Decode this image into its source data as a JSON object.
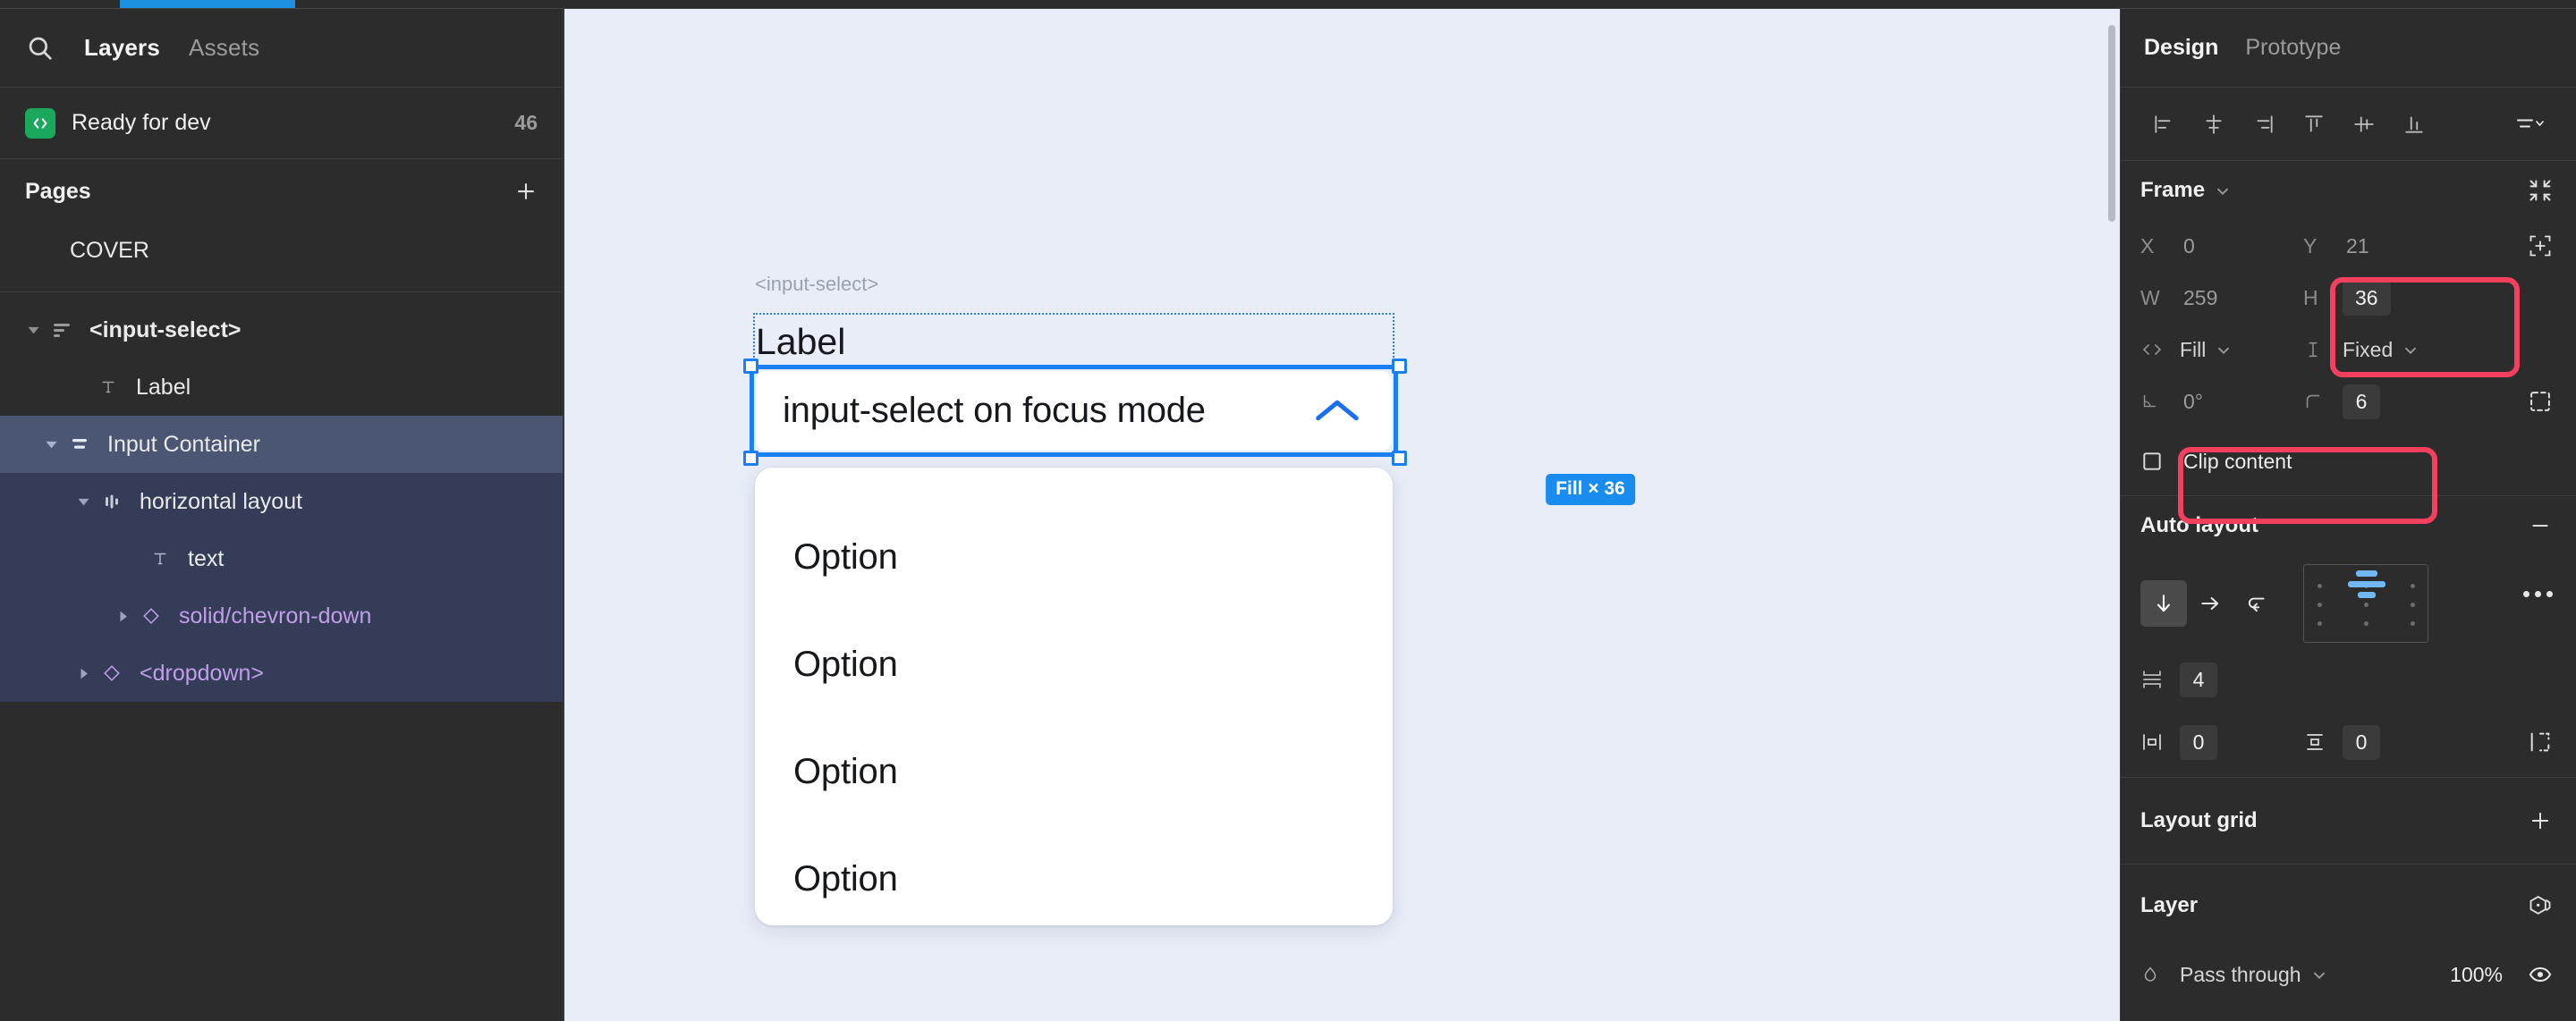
{
  "app": {
    "accent_blue": "#1a8cf0",
    "annotation_color": "#f43f5e",
    "canvas_bg": "#e9edf7",
    "panel_bg": "#2c2c2c"
  },
  "left_panel": {
    "tabs": [
      {
        "label": "Layers",
        "active": true
      },
      {
        "label": "Assets",
        "active": false
      }
    ],
    "search_icon": "search-icon",
    "dev_status": {
      "icon": "code-brackets-icon",
      "label": "Ready for dev",
      "count": "46"
    },
    "pages": {
      "title": "Pages",
      "add_icon": "plus-icon",
      "items": [
        {
          "label": "COVER",
          "selected": false
        }
      ]
    },
    "layers": [
      {
        "name": "<input-select>",
        "icon": "auto-layout-vertical-icon",
        "caret": "down",
        "indent": 0,
        "bold": true,
        "component": false,
        "selection": "none"
      },
      {
        "name": "Label",
        "icon": "text-icon",
        "caret": "none",
        "indent": 1,
        "bold": false,
        "component": false,
        "selection": "none"
      },
      {
        "name": "Input Container",
        "icon": "auto-layout-vertical-icon",
        "caret": "down",
        "indent": 1,
        "bold": false,
        "component": false,
        "selection": "light"
      },
      {
        "name": "horizontal layout",
        "icon": "auto-layout-horizontal-icon",
        "caret": "down",
        "indent": 2,
        "bold": false,
        "component": false,
        "selection": "dark"
      },
      {
        "name": "text",
        "icon": "text-icon",
        "caret": "none",
        "indent": 3,
        "bold": false,
        "component": false,
        "selection": "dark"
      },
      {
        "name": "solid/chevron-down",
        "icon": "component-instance-icon",
        "caret": "right",
        "indent": 3,
        "bold": false,
        "component": true,
        "selection": "dark"
      },
      {
        "name": "<dropdown>",
        "icon": "component-instance-icon",
        "caret": "right",
        "indent": 2,
        "bold": false,
        "component": true,
        "selection": "dark"
      }
    ]
  },
  "canvas": {
    "frame_name": "<input-select>",
    "label_text": "Label",
    "input_value": "input-select on focus mode",
    "input_chevron": "chevron-up-icon",
    "fill_badge": "Fill × 36",
    "dropdown_options": [
      "Option",
      "Option",
      "Option",
      "Option"
    ]
  },
  "right_panel": {
    "tabs": [
      {
        "label": "Design",
        "active": true
      },
      {
        "label": "Prototype",
        "active": false
      }
    ],
    "align_buttons": [
      "align-left-icon",
      "align-horizontal-center-icon",
      "align-right-icon",
      "align-top-icon",
      "align-vertical-center-icon",
      "align-bottom-icon",
      "distribute-more-icon"
    ],
    "frame": {
      "title": "Frame",
      "collapse_icon": "chevron-down-icon",
      "resize_icon": "resize-to-fit-icon",
      "x_label": "X",
      "x_value": "0",
      "y_label": "Y",
      "y_value": "21",
      "w_label": "W",
      "w_value": "259",
      "h_label": "H",
      "h_value": "36",
      "absolute_position_icon": "absolute-position-icon",
      "horizontal_resizing_icon": "horizontal-resizing-icon",
      "horizontal_resizing_value": "Fill",
      "vertical_resizing_icon": "vertical-resizing-icon",
      "vertical_resizing_value": "Fixed",
      "rotation_icon": "rotation-icon",
      "rotation_value": "0°",
      "corner_radius_icon": "corner-radius-icon",
      "corner_radius_value": "6",
      "independent_corners_icon": "independent-corners-icon",
      "clip_content_label": "Clip content",
      "clip_content_checked": false
    },
    "auto_layout": {
      "title": "Auto layout",
      "remove_icon": "minus-icon",
      "direction_vertical_icon": "arrow-down-icon",
      "direction_horizontal_icon": "arrow-right-icon",
      "wrap_icon": "wrap-icon",
      "direction_selected": "vertical",
      "alignment": "top-center",
      "gap_icon": "gap-icon",
      "gap_value": "4",
      "more_icon": "more-options-icon",
      "padding_h_icon": "padding-horizontal-icon",
      "padding_h_value": "0",
      "padding_v_icon": "padding-vertical-icon",
      "padding_v_value": "0",
      "individual_padding_icon": "individual-padding-icon"
    },
    "layout_grid": {
      "title": "Layout grid",
      "add_icon": "plus-icon"
    },
    "layer": {
      "title": "Layer",
      "styles_icon": "layer-styles-icon",
      "blend_icon": "blend-mode-icon",
      "blend_mode": "Pass through",
      "blend_chevron": "chevron-down-icon",
      "opacity": "100%",
      "visibility_icon": "eye-icon"
    }
  }
}
